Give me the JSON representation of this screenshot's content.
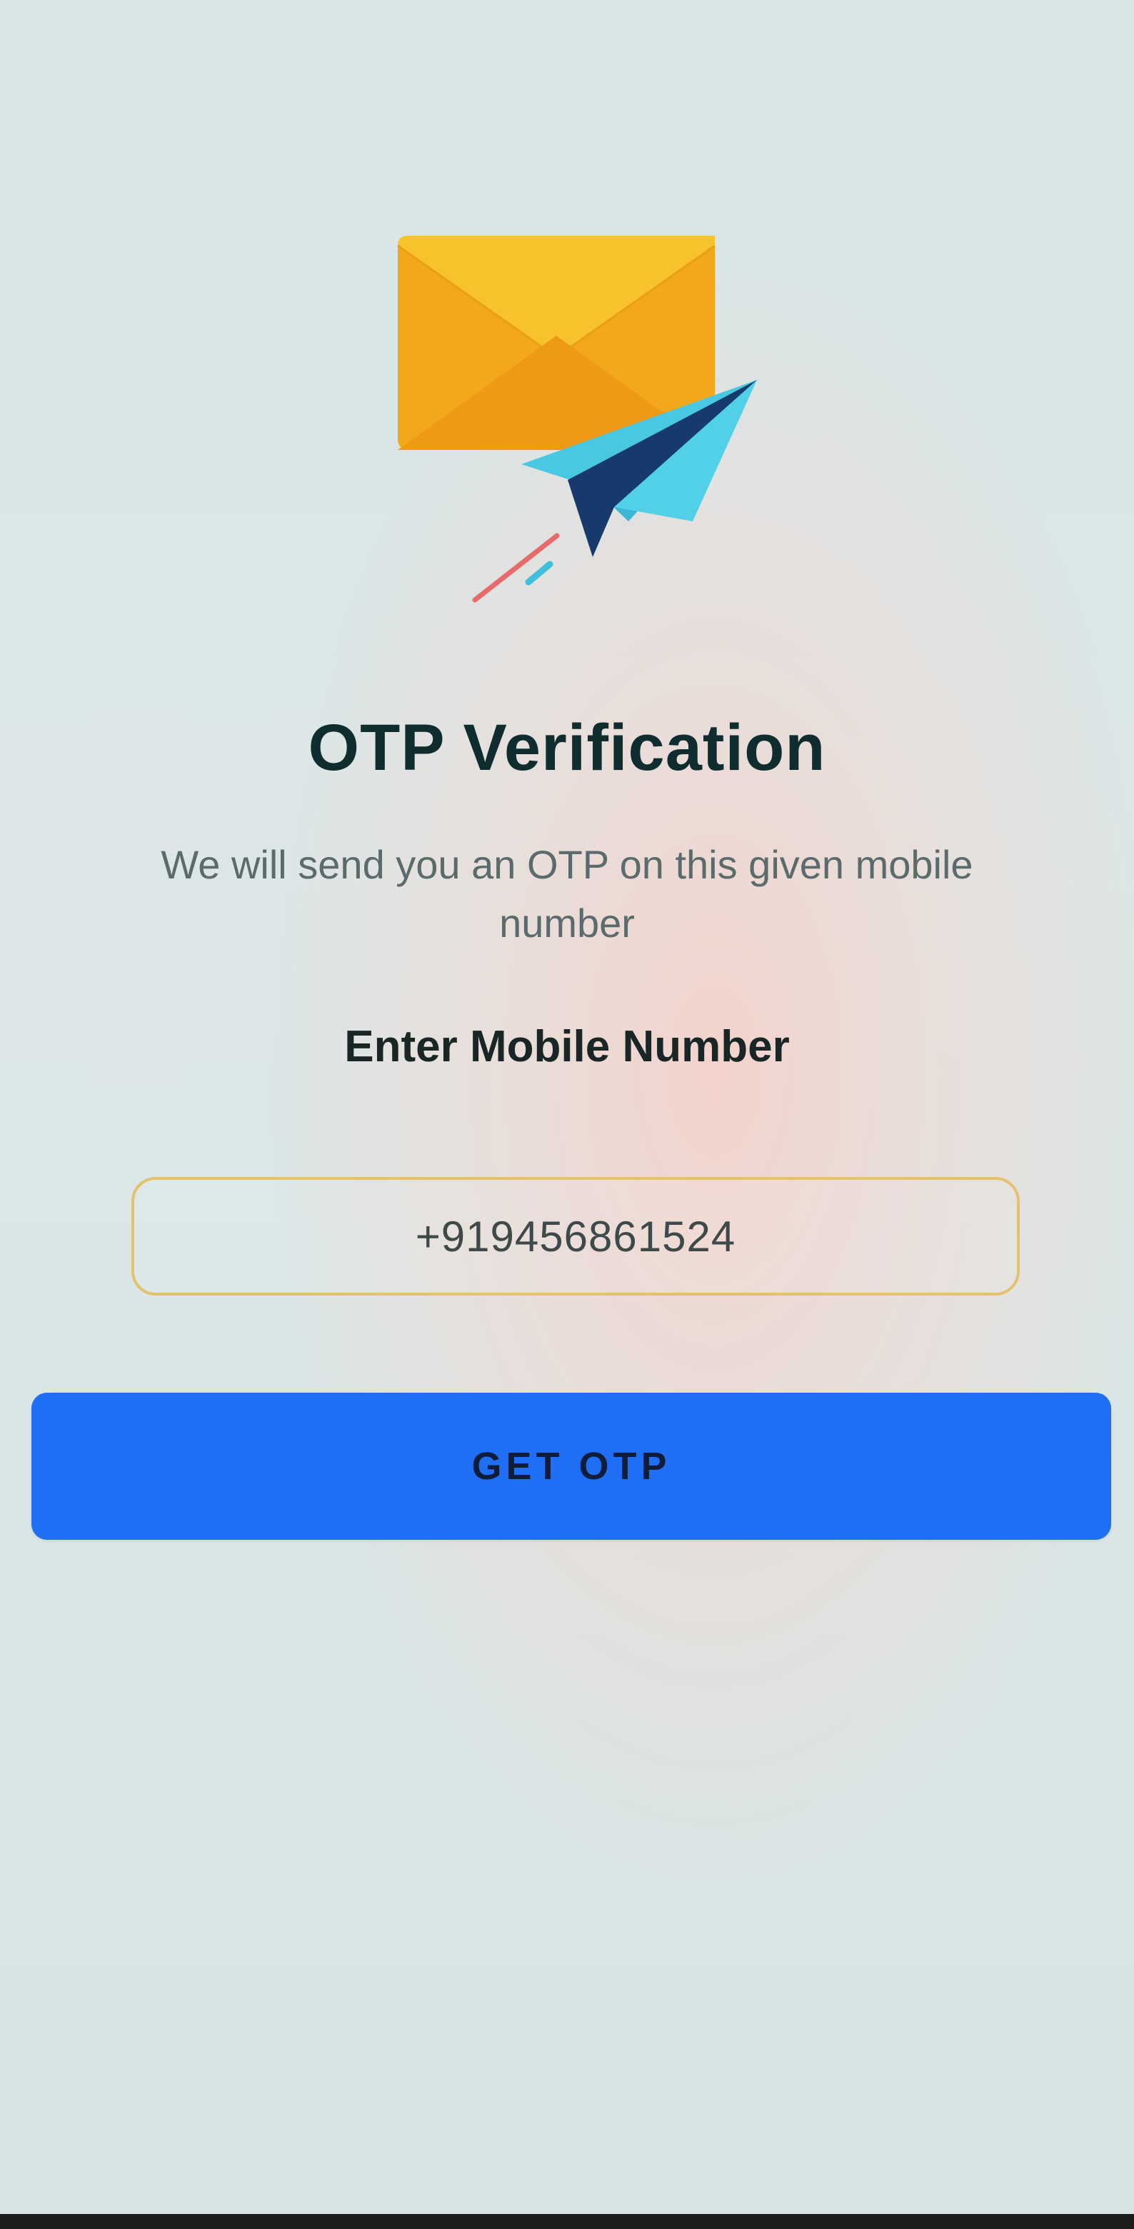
{
  "screen": {
    "title": "OTP Verification",
    "subtitle": "We will send you an OTP on this given mobile number",
    "field_label": "Enter Mobile Number",
    "phone_value": "+919456861524",
    "button_label": "GET OTP"
  },
  "illustration": {
    "icons": [
      "envelope-icon",
      "paper-plane-icon"
    ]
  },
  "colors": {
    "accent": "#1f6ff4",
    "field_border": "#e2c26c",
    "envelope": "#f5b21a",
    "plane": "#3fc4df"
  }
}
